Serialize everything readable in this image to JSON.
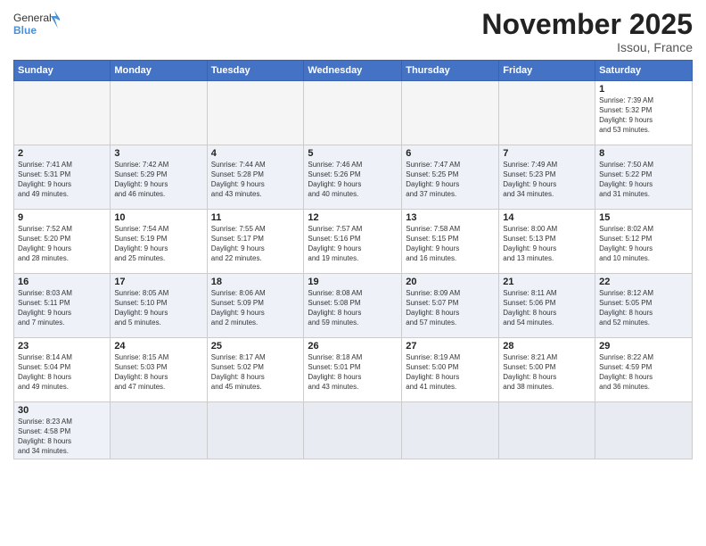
{
  "header": {
    "logo_general": "General",
    "logo_blue": "Blue",
    "month": "November 2025",
    "location": "Issou, France"
  },
  "weekdays": [
    "Sunday",
    "Monday",
    "Tuesday",
    "Wednesday",
    "Thursday",
    "Friday",
    "Saturday"
  ],
  "weeks": [
    [
      {
        "day": "",
        "info": ""
      },
      {
        "day": "",
        "info": ""
      },
      {
        "day": "",
        "info": ""
      },
      {
        "day": "",
        "info": ""
      },
      {
        "day": "",
        "info": ""
      },
      {
        "day": "",
        "info": ""
      },
      {
        "day": "1",
        "info": "Sunrise: 7:39 AM\nSunset: 5:32 PM\nDaylight: 9 hours\nand 53 minutes."
      }
    ],
    [
      {
        "day": "2",
        "info": "Sunrise: 7:41 AM\nSunset: 5:31 PM\nDaylight: 9 hours\nand 49 minutes."
      },
      {
        "day": "3",
        "info": "Sunrise: 7:42 AM\nSunset: 5:29 PM\nDaylight: 9 hours\nand 46 minutes."
      },
      {
        "day": "4",
        "info": "Sunrise: 7:44 AM\nSunset: 5:28 PM\nDaylight: 9 hours\nand 43 minutes."
      },
      {
        "day": "5",
        "info": "Sunrise: 7:46 AM\nSunset: 5:26 PM\nDaylight: 9 hours\nand 40 minutes."
      },
      {
        "day": "6",
        "info": "Sunrise: 7:47 AM\nSunset: 5:25 PM\nDaylight: 9 hours\nand 37 minutes."
      },
      {
        "day": "7",
        "info": "Sunrise: 7:49 AM\nSunset: 5:23 PM\nDaylight: 9 hours\nand 34 minutes."
      },
      {
        "day": "8",
        "info": "Sunrise: 7:50 AM\nSunset: 5:22 PM\nDaylight: 9 hours\nand 31 minutes."
      }
    ],
    [
      {
        "day": "9",
        "info": "Sunrise: 7:52 AM\nSunset: 5:20 PM\nDaylight: 9 hours\nand 28 minutes."
      },
      {
        "day": "10",
        "info": "Sunrise: 7:54 AM\nSunset: 5:19 PM\nDaylight: 9 hours\nand 25 minutes."
      },
      {
        "day": "11",
        "info": "Sunrise: 7:55 AM\nSunset: 5:17 PM\nDaylight: 9 hours\nand 22 minutes."
      },
      {
        "day": "12",
        "info": "Sunrise: 7:57 AM\nSunset: 5:16 PM\nDaylight: 9 hours\nand 19 minutes."
      },
      {
        "day": "13",
        "info": "Sunrise: 7:58 AM\nSunset: 5:15 PM\nDaylight: 9 hours\nand 16 minutes."
      },
      {
        "day": "14",
        "info": "Sunrise: 8:00 AM\nSunset: 5:13 PM\nDaylight: 9 hours\nand 13 minutes."
      },
      {
        "day": "15",
        "info": "Sunrise: 8:02 AM\nSunset: 5:12 PM\nDaylight: 9 hours\nand 10 minutes."
      }
    ],
    [
      {
        "day": "16",
        "info": "Sunrise: 8:03 AM\nSunset: 5:11 PM\nDaylight: 9 hours\nand 7 minutes."
      },
      {
        "day": "17",
        "info": "Sunrise: 8:05 AM\nSunset: 5:10 PM\nDaylight: 9 hours\nand 5 minutes."
      },
      {
        "day": "18",
        "info": "Sunrise: 8:06 AM\nSunset: 5:09 PM\nDaylight: 9 hours\nand 2 minutes."
      },
      {
        "day": "19",
        "info": "Sunrise: 8:08 AM\nSunset: 5:08 PM\nDaylight: 8 hours\nand 59 minutes."
      },
      {
        "day": "20",
        "info": "Sunrise: 8:09 AM\nSunset: 5:07 PM\nDaylight: 8 hours\nand 57 minutes."
      },
      {
        "day": "21",
        "info": "Sunrise: 8:11 AM\nSunset: 5:06 PM\nDaylight: 8 hours\nand 54 minutes."
      },
      {
        "day": "22",
        "info": "Sunrise: 8:12 AM\nSunset: 5:05 PM\nDaylight: 8 hours\nand 52 minutes."
      }
    ],
    [
      {
        "day": "23",
        "info": "Sunrise: 8:14 AM\nSunset: 5:04 PM\nDaylight: 8 hours\nand 49 minutes."
      },
      {
        "day": "24",
        "info": "Sunrise: 8:15 AM\nSunset: 5:03 PM\nDaylight: 8 hours\nand 47 minutes."
      },
      {
        "day": "25",
        "info": "Sunrise: 8:17 AM\nSunset: 5:02 PM\nDaylight: 8 hours\nand 45 minutes."
      },
      {
        "day": "26",
        "info": "Sunrise: 8:18 AM\nSunset: 5:01 PM\nDaylight: 8 hours\nand 43 minutes."
      },
      {
        "day": "27",
        "info": "Sunrise: 8:19 AM\nSunset: 5:00 PM\nDaylight: 8 hours\nand 41 minutes."
      },
      {
        "day": "28",
        "info": "Sunrise: 8:21 AM\nSunset: 5:00 PM\nDaylight: 8 hours\nand 38 minutes."
      },
      {
        "day": "29",
        "info": "Sunrise: 8:22 AM\nSunset: 4:59 PM\nDaylight: 8 hours\nand 36 minutes."
      }
    ],
    [
      {
        "day": "30",
        "info": "Sunrise: 8:23 AM\nSunset: 4:58 PM\nDaylight: 8 hours\nand 34 minutes."
      },
      {
        "day": "",
        "info": ""
      },
      {
        "day": "",
        "info": ""
      },
      {
        "day": "",
        "info": ""
      },
      {
        "day": "",
        "info": ""
      },
      {
        "day": "",
        "info": ""
      },
      {
        "day": "",
        "info": ""
      }
    ]
  ]
}
